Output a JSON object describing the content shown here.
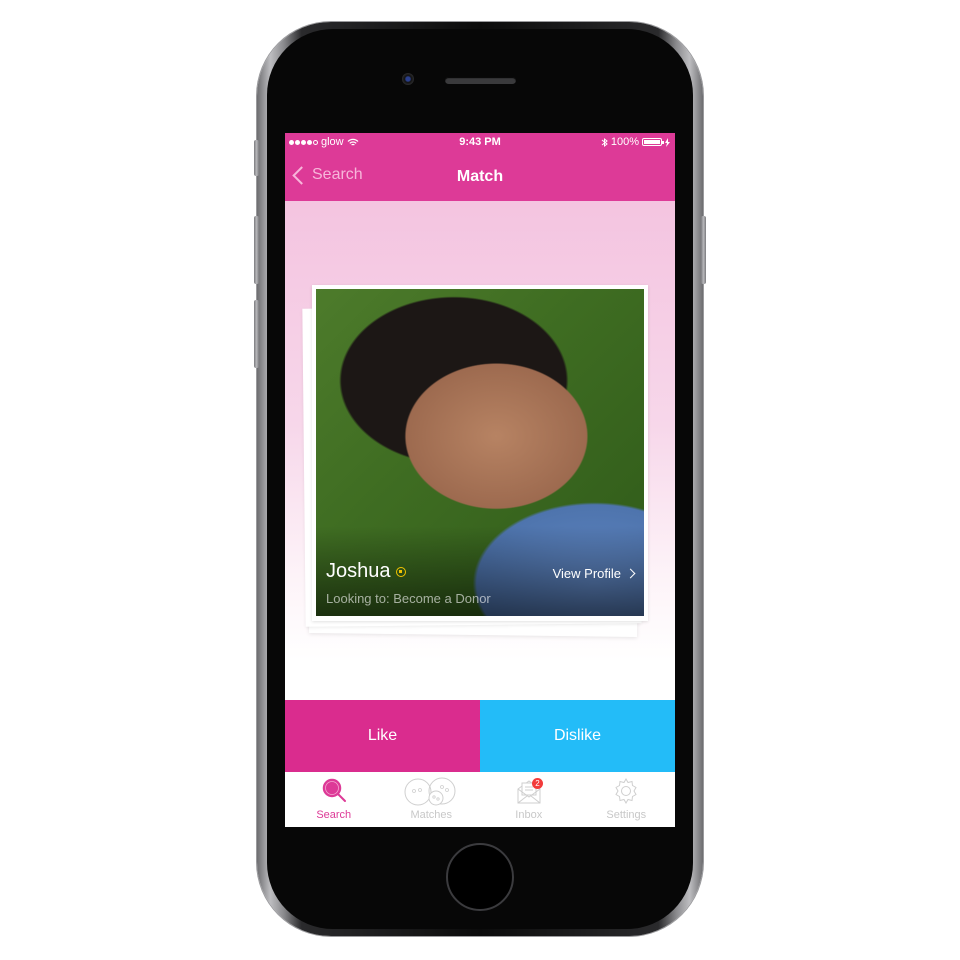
{
  "status_bar": {
    "carrier": "glow",
    "signal_bars_filled": 4,
    "signal_bars_total": 5,
    "time": "9:43 PM",
    "battery": "100%"
  },
  "nav": {
    "back_label": "Search",
    "title": "Match"
  },
  "profile": {
    "name": "Joshua",
    "looking_to": "Looking to: Become a Donor",
    "view_profile_label": "View Profile"
  },
  "actions": {
    "like_label": "Like",
    "dislike_label": "Dislike"
  },
  "tabs": [
    {
      "label": "Search",
      "icon": "search-icon",
      "active": true
    },
    {
      "label": "Matches",
      "icon": "matches-icon",
      "active": false
    },
    {
      "label": "Inbox",
      "icon": "inbox-icon",
      "active": false,
      "badge": "2"
    },
    {
      "label": "Settings",
      "icon": "gear-icon",
      "active": false
    }
  ],
  "colors": {
    "brand_pink": "#dd3a97",
    "like": "#da2c8e",
    "dislike": "#23bcf8",
    "badge": "#f23b3b"
  }
}
